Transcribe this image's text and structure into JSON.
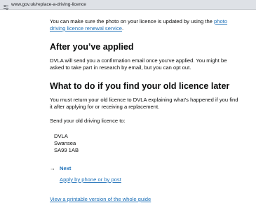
{
  "browser": {
    "url": "www.gov.uk/replace-a-driving-licence",
    "site_icon": "site-info-icon"
  },
  "intro": {
    "text_before": "You can make sure the photo on your licence is updated by using the ",
    "link_text": "photo driving licence renewal service",
    "text_after": "."
  },
  "after_applied": {
    "heading": "After you’ve applied",
    "body": "DVLA will send you a confirmation email once you’ve applied. You might be asked to take part in research by email, but you can opt out."
  },
  "old_licence": {
    "heading": "What to do if you find your old licence later",
    "body": "You must return your old licence to DVLA explaining what’s happened if you find it after applying for or receiving a replacement.",
    "send_to": "Send your old driving licence to:",
    "address": [
      "DVLA",
      "Swansea",
      "SA99 1AB"
    ]
  },
  "next_nav": {
    "arrow": "→",
    "label": "Next",
    "link": "Apply by phone or by post"
  },
  "printable_link": "View a printable version of the whole guide",
  "colors": {
    "link": "#1d70b8",
    "text": "#0b0c0c"
  }
}
